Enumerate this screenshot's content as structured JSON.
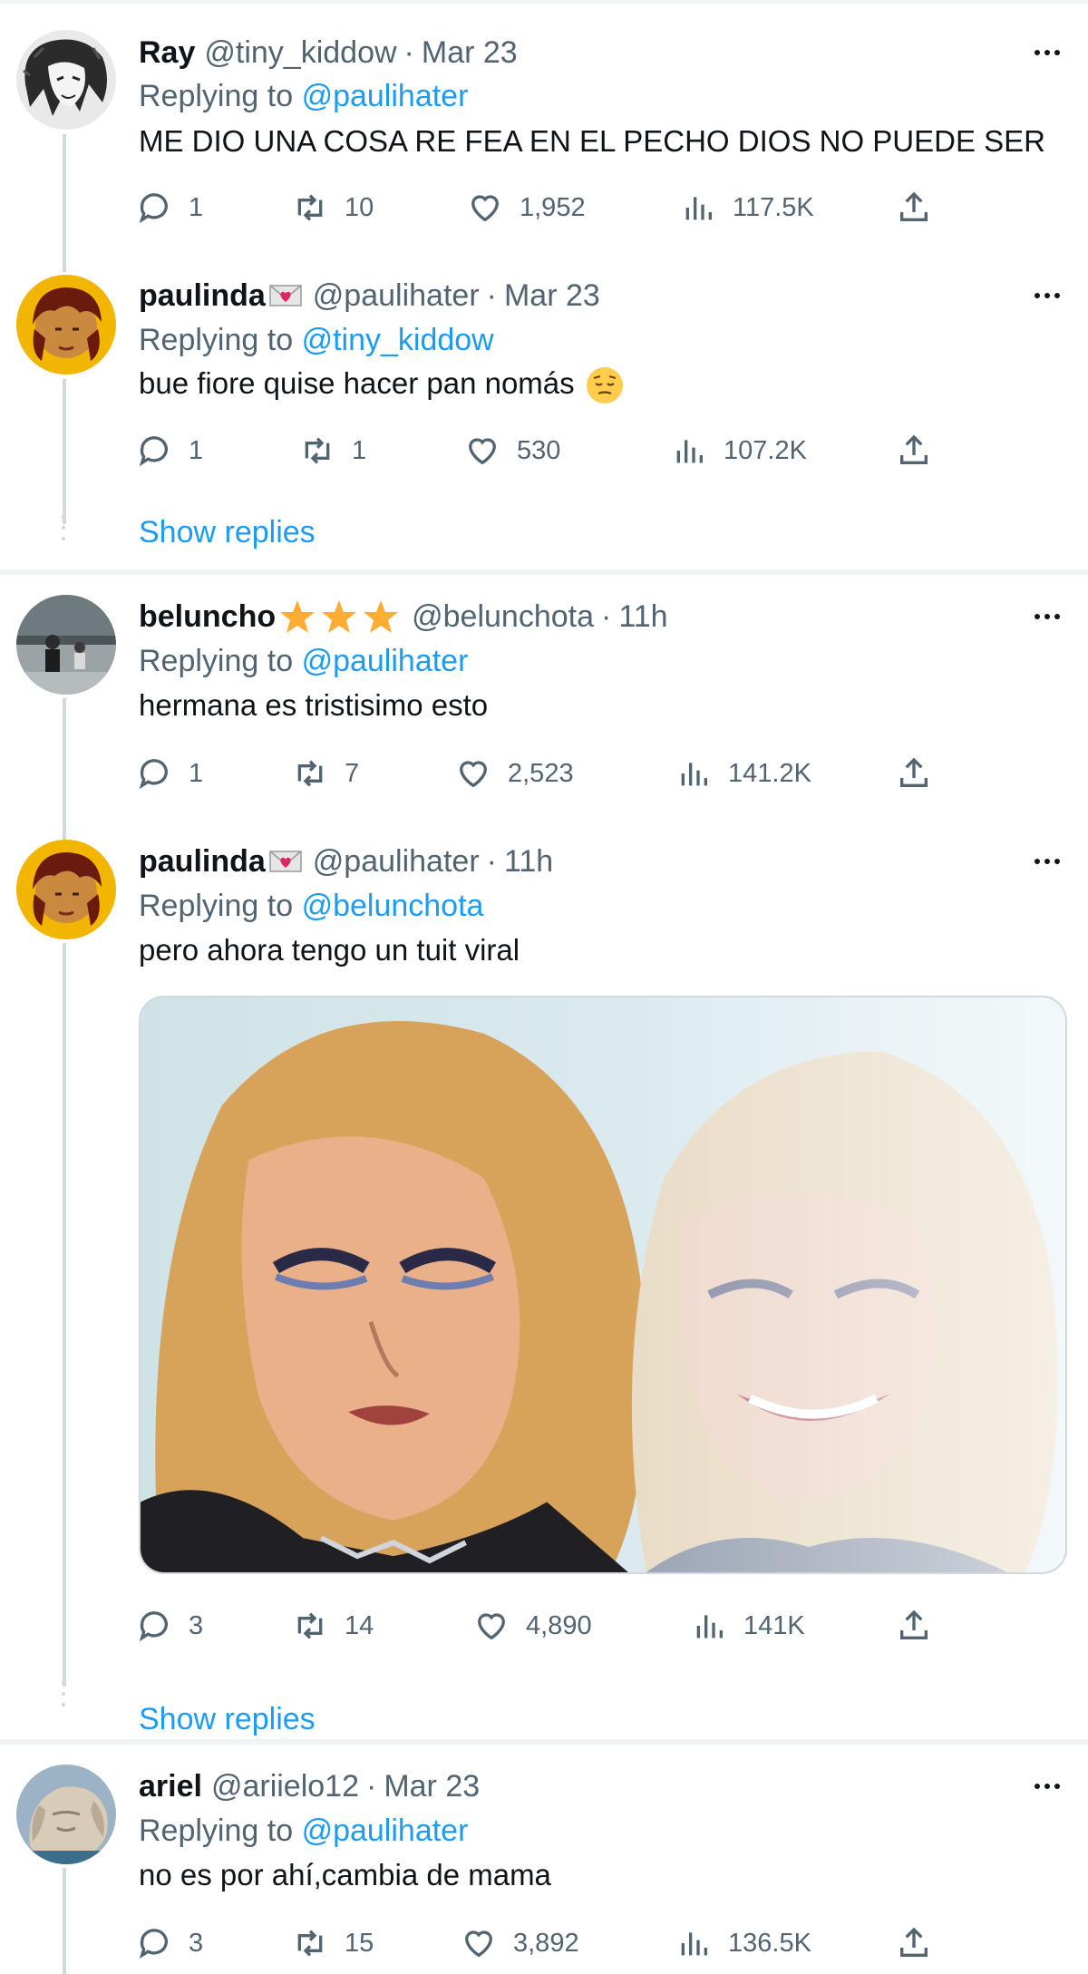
{
  "tweets": [
    {
      "name": "Ray",
      "handle": "@tiny_kiddow",
      "time": "Mar 23",
      "replying_prefix": "Replying to",
      "replying_to": "@paulihater",
      "text": "ME DIO UNA COSA RE FEA EN EL PECHO DIOS NO PUEDE SER",
      "replies": "1",
      "retweets": "10",
      "likes": "1,952",
      "views": "117.5K",
      "avatar_icon": "manga-character-avatar"
    },
    {
      "name": "paulinda",
      "handle": "@paulihater",
      "time": "Mar 23",
      "replying_prefix": "Replying to",
      "replying_to": "@tiny_kiddow",
      "text": "bue fiore quise hacer pan nomás",
      "text_emoji": "pensive-face-emoji",
      "replies": "1",
      "retweets": "1",
      "likes": "530",
      "views": "107.2K",
      "name_emoji": "love-letter-emoji",
      "avatar_icon": "red-hair-portrait-avatar"
    },
    {
      "name": "beluncho",
      "handle": "@belunchota",
      "time": "11h",
      "replying_prefix": "Replying to",
      "replying_to": "@paulihater",
      "text": "hermana es tristisimo esto",
      "replies": "1",
      "retweets": "7",
      "likes": "2,523",
      "views": "141.2K",
      "name_emoji": "three-stars-emoji",
      "avatar_icon": "people-on-bench-avatar"
    },
    {
      "name": "paulinda",
      "handle": "@paulihater",
      "time": "11h",
      "replying_prefix": "Replying to",
      "replying_to": "@belunchota",
      "text": "pero ahora tengo un tuit viral",
      "replies": "3",
      "retweets": "14",
      "likes": "4,890",
      "views": "141K",
      "name_emoji": "love-letter-emoji",
      "avatar_icon": "red-hair-portrait-avatar",
      "media_icon": "blonde-woman-sad-happy-meme-image"
    },
    {
      "name": "ariel",
      "handle": "@ariielo12",
      "time": "Mar 23",
      "replying_prefix": "Replying to",
      "replying_to": "@paulihater",
      "text": "no es por ahí,cambia de mama",
      "replies": "3",
      "retweets": "15",
      "likes": "3,892",
      "views": "136.5K",
      "avatar_icon": "dog-sculpture-avatar"
    }
  ],
  "show_replies_label": "Show replies",
  "colors": {
    "accent": "#1d9bf0",
    "secondary_text": "#536471",
    "primary_text": "#0f1419",
    "divider": "#eff3f4"
  }
}
